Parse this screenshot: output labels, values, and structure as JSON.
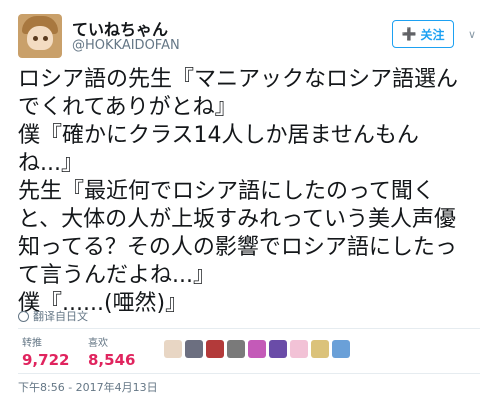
{
  "user": {
    "display_name": "ていねちゃん",
    "handle": "@HOKKAIDOFAN"
  },
  "follow_button": {
    "label": "关注",
    "icon": "add-user-icon"
  },
  "menu_icon": "chevron-down-icon",
  "tweet": {
    "lines": [
      "ロシア語の先生『マニアックなロシア語選ん",
      "でくれてありがとね』",
      "僕『確かにクラス14人しか居ませんもん",
      "ね...』",
      "先生『最近何でロシア語にしたのって聞く",
      "と、大体の人が上坂すみれっていう美人声優",
      "知ってる？その人の影響でロシア語にしたっ",
      "て言うんだよね...』",
      "僕『......(唖然)』"
    ]
  },
  "translate_label": "翻译自日文",
  "stats": {
    "retweets": {
      "label": "转推",
      "value": "9,722"
    },
    "likes": {
      "label": "喜欢",
      "value": "8,546"
    }
  },
  "liker_avatar_colors": [
    "#e8d6c4",
    "#6c6f80",
    "#b33a3a",
    "#7a7a7a",
    "#c45ab8",
    "#6a4ca8",
    "#f2c2d6",
    "#dbc27a",
    "#6aa0d8"
  ],
  "timestamp": "下午8:56 - 2017年4月13日"
}
